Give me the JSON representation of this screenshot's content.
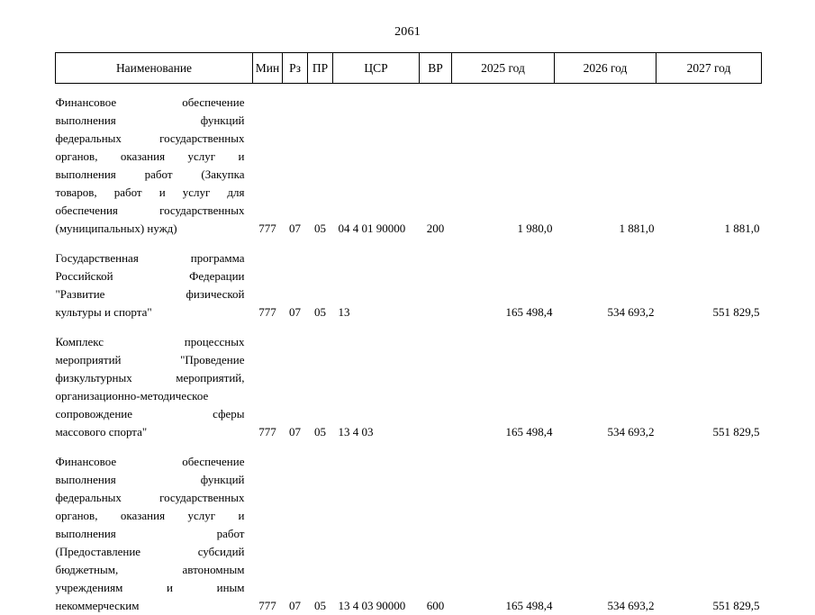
{
  "page": {
    "number": "2061"
  },
  "table": {
    "headers": {
      "name": "Наименование",
      "min": "Мин",
      "rz": "Рз",
      "pr": "ПР",
      "csr": "ЦСР",
      "vr": "ВР",
      "year1": "2025 год",
      "year2": "2026 год",
      "year3": "2027 год"
    },
    "rows": [
      {
        "name_lines": [
          "Финансовое обеспечение",
          "выполнения функций",
          "федеральных государственных",
          "органов, оказания услуг и",
          "выполнения работ (Закупка",
          "товаров, работ и услуг для",
          "обеспечения государственных",
          "(муниципальных) нужд)"
        ],
        "min": "777",
        "rz": "07",
        "pr": "05",
        "csr": "04 4 01 90000",
        "vr": "200",
        "year1": "1 980,0",
        "year2": "1 881,0",
        "year3": "1 881,0"
      },
      {
        "name_lines": [
          "Государственная программа",
          "Российской Федерации",
          "\"Развитие физической",
          "культуры и спорта\""
        ],
        "min": "777",
        "rz": "07",
        "pr": "05",
        "csr": "13",
        "vr": "",
        "year1": "165 498,4",
        "year2": "534 693,2",
        "year3": "551 829,5"
      },
      {
        "name_lines": [
          "Комплекс процессных",
          "мероприятий \"Проведение",
          "физкультурных мероприятий,",
          "организационно-методическое",
          "сопровождение сферы",
          "массового спорта\""
        ],
        "min": "777",
        "rz": "07",
        "pr": "05",
        "csr": "13 4 03",
        "vr": "",
        "year1": "165 498,4",
        "year2": "534 693,2",
        "year3": "551 829,5"
      },
      {
        "name_lines": [
          "Финансовое обеспечение",
          "выполнения функций",
          "федеральных государственных",
          "органов, оказания услуг и",
          "выполнения работ",
          "(Предоставление субсидий",
          "бюджетным, автономным",
          "учреждениям и иным",
          "некоммерческим"
        ],
        "min": "777",
        "rz": "07",
        "pr": "05",
        "csr": "13 4 03 90000",
        "vr": "600",
        "year1": "165 498,4",
        "year2": "534 693,2",
        "year3": "551 829,5"
      }
    ]
  }
}
